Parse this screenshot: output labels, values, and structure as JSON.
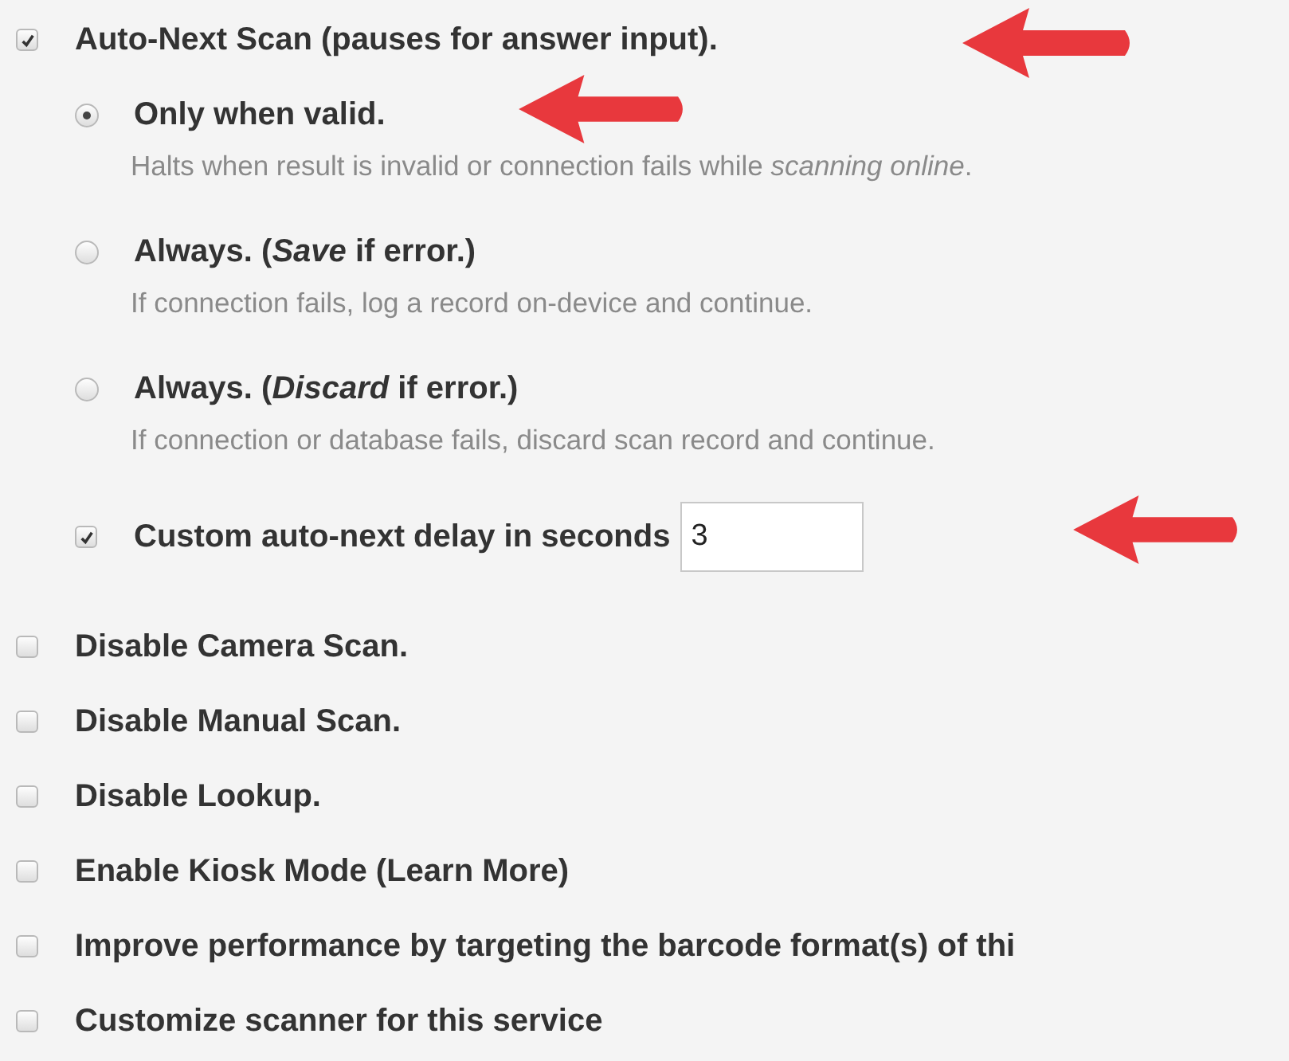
{
  "auto_next": {
    "label": "Auto-Next Scan (pauses for answer input).",
    "checked": true,
    "modes": [
      {
        "label": "Only when valid.",
        "selected": true,
        "description": "Halts when result is invalid or connection fails while *scanning online*."
      },
      {
        "label": "Always. (*Save* if error.)",
        "selected": false,
        "description": "If connection fails, log a record on-device and continue."
      },
      {
        "label": "Always. (*Discard* if error.)",
        "selected": false,
        "description": "If connection or database fails, discard scan record and continue."
      }
    ],
    "custom_delay": {
      "label": "Custom auto-next delay in seconds",
      "checked": true,
      "value": "3"
    }
  },
  "options": [
    {
      "label": "Disable Camera Scan.",
      "checked": false
    },
    {
      "label": "Disable Manual Scan.",
      "checked": false
    },
    {
      "label": "Disable Lookup.",
      "checked": false
    },
    {
      "label": "Enable Kiosk Mode (Learn More)",
      "checked": false
    },
    {
      "label": "Improve performance by targeting the barcode format(s) of thi",
      "checked": false
    },
    {
      "label": "Customize scanner for this service",
      "checked": false
    }
  ]
}
